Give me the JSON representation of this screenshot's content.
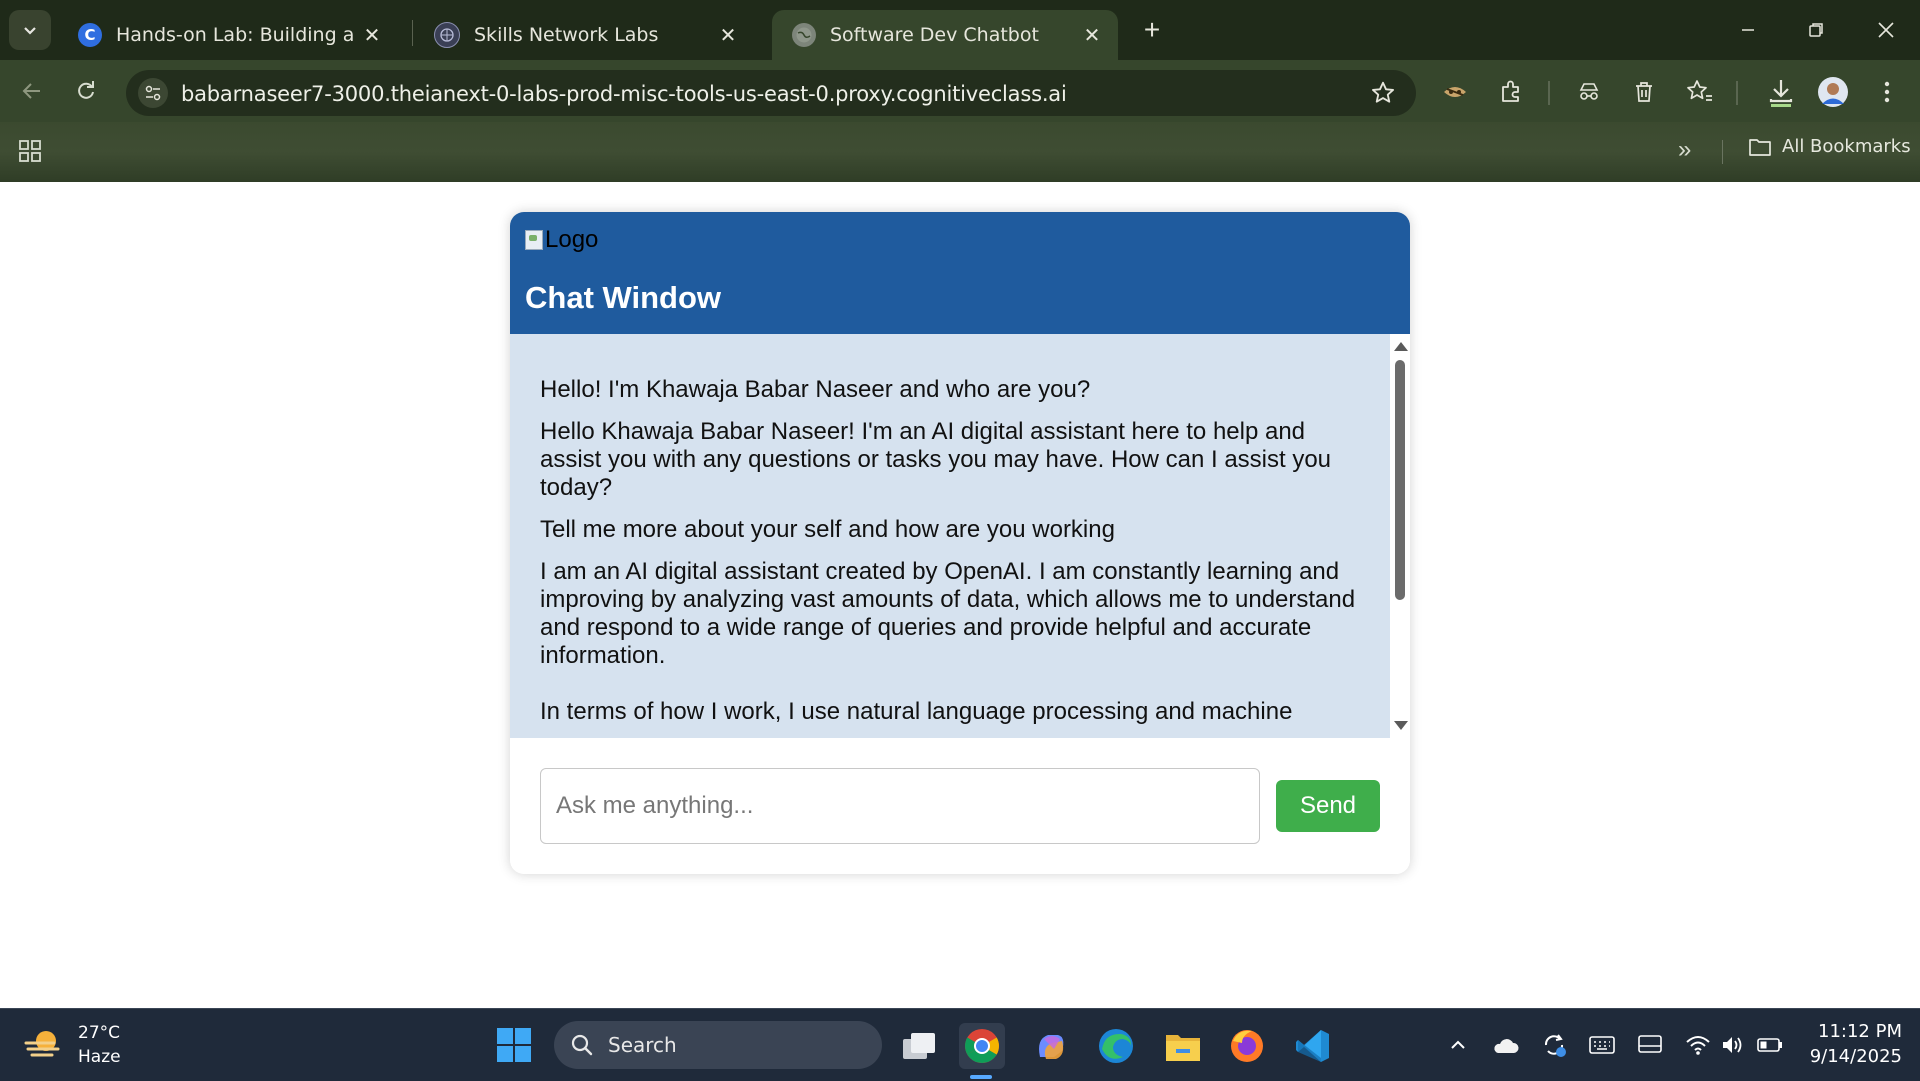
{
  "browser": {
    "tabs": [
      {
        "title": "Hands-on Lab: Building a Basic",
        "favicon": "coursera-c-icon"
      },
      {
        "title": "Skills Network Labs",
        "favicon": "skills-network-icon"
      },
      {
        "title": "Software Dev Chatbot",
        "favicon": "globe-icon"
      }
    ],
    "url": "babarnaseer7-3000.theianext-0-labs-prod-misc-tools-us-east-0.proxy.cognitiveclass.ai",
    "bookmarks_label": "All Bookmarks"
  },
  "chat": {
    "logo_alt": "Logo",
    "title": "Chat Window",
    "messages": [
      {
        "role": "user",
        "paragraphs": [
          "Hello! I'm Khawaja Babar Naseer and who are you?"
        ]
      },
      {
        "role": "bot",
        "paragraphs": [
          "Hello Khawaja Babar Naseer! I'm an AI digital assistant here to help and assist you with any questions or tasks you may have. How can I assist you today?"
        ]
      },
      {
        "role": "user",
        "paragraphs": [
          "Tell me more about your self and how are you working"
        ]
      },
      {
        "role": "bot",
        "paragraphs": [
          "I am an AI digital assistant created by OpenAI. I am constantly learning and improving by analyzing vast amounts of data, which allows me to understand and respond to a wide range of queries and provide helpful and accurate information.",
          "In terms of how I work, I use natural language processing and machine"
        ]
      }
    ],
    "input_placeholder": "Ask me anything...",
    "send_label": "Send"
  },
  "taskbar": {
    "weather_temp": "27°C",
    "weather_desc": "Haze",
    "search_label": "Search",
    "time": "11:12 PM",
    "date": "9/14/2025"
  }
}
